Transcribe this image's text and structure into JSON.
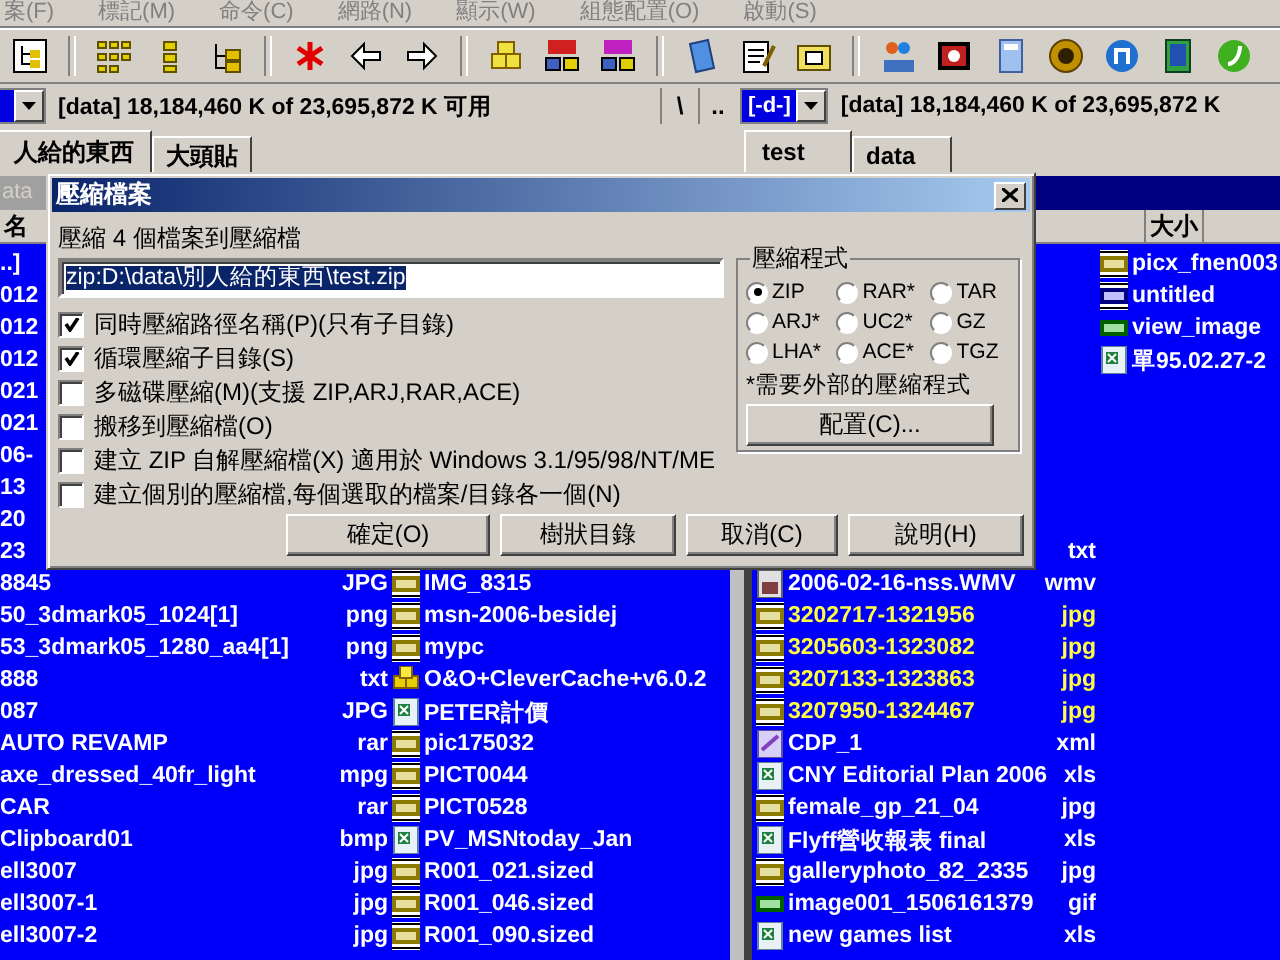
{
  "menu": [
    {
      "label": "案(F)"
    },
    {
      "label": "標記(M)"
    },
    {
      "label": "命令(C)"
    },
    {
      "label": "網路(N)"
    },
    {
      "label": "顯示(W)"
    },
    {
      "label": "組態配置(O)"
    },
    {
      "label": "啟動(S)"
    }
  ],
  "left_drive": {
    "info": "[data]  18,184,460 K of 23,695,872 K 可用"
  },
  "nav_buttons": [
    "\\",
    ".."
  ],
  "right_drive": {
    "drive": "[-d-]",
    "info": "[data]  18,184,460 K of 23,695,872 K"
  },
  "left_tabs": [
    {
      "label": "人給的東西",
      "selected": true
    },
    {
      "label": "大頭貼",
      "selected": false
    }
  ],
  "right_tabs": [
    {
      "label": "test",
      "selected": true
    },
    {
      "label": "data",
      "selected": false
    }
  ],
  "panels": [
    {
      "path": "ata",
      "name_header": "名",
      "columns": [
        [
          {
            "name": "..]",
            "selected": false
          },
          {
            "name": "012",
            "selected": false
          },
          {
            "name": "012",
            "selected": false
          },
          {
            "name": "012",
            "selected": false
          },
          {
            "name": "021",
            "selected": false
          },
          {
            "name": "021",
            "selected": false
          },
          {
            "name": "06-",
            "selected": false
          },
          {
            "name": "13",
            "selected": false
          },
          {
            "name": "20",
            "selected": false
          },
          {
            "name": "23",
            "selected": false
          },
          {
            "name": "8845",
            "ext": "JPG",
            "selected": false
          },
          {
            "name": "50_3dmark05_1024[1]",
            "ext": "png",
            "selected": false
          },
          {
            "name": "53_3dmark05_1280_aa4[1]",
            "ext": "png",
            "selected": false
          },
          {
            "name": "888",
            "ext": "txt",
            "selected": false
          },
          {
            "name": "087",
            "ext": "JPG",
            "selected": false
          },
          {
            "name": "AUTO REVAMP",
            "ext": "rar",
            "selected": false
          },
          {
            "name": "axe_dressed_40fr_light",
            "ext": "mpg",
            "selected": false
          },
          {
            "name": "CAR",
            "ext": "rar",
            "selected": false
          },
          {
            "name": "Clipboard01",
            "ext": "bmp",
            "selected": false
          },
          {
            "name": "ell3007",
            "ext": "jpg",
            "selected": false
          },
          {
            "name": "ell3007-1",
            "ext": "jpg",
            "selected": false
          },
          {
            "name": "ell3007-2",
            "ext": "jpg",
            "selected": false
          }
        ],
        [
          {
            "name": "IMG_8315",
            "kind": "jpg",
            "selected": false
          },
          {
            "name": "msn-2006-besidej",
            "kind": "jpg",
            "selected": false
          },
          {
            "name": "mypc",
            "kind": "jpg",
            "selected": false
          },
          {
            "name": "O&O+CleverCache+v6.0.2",
            "kind": "rar",
            "selected": false
          },
          {
            "name": "PETER計價",
            "kind": "xls",
            "selected": false
          },
          {
            "name": "pic175032",
            "kind": "jpg",
            "selected": false
          },
          {
            "name": "PICT0044",
            "kind": "jpg",
            "selected": false
          },
          {
            "name": "PICT0528",
            "kind": "jpg",
            "selected": false
          },
          {
            "name": "PV_MSNtoday_Jan",
            "kind": "xls",
            "selected": false
          },
          {
            "name": "R001_021.sized",
            "kind": "jpg",
            "selected": false
          },
          {
            "name": "R001_046.sized",
            "kind": "jpg",
            "selected": false
          },
          {
            "name": "R001_090.sized",
            "kind": "jpg",
            "selected": false
          }
        ]
      ]
    },
    {
      "size_header": "大小",
      "columns": [
        [
          {
            "ext": "txt",
            "selected": false
          },
          {
            "name": "2006-02-16-nss.WMV",
            "ext": "wmv",
            "kind": "wmv",
            "selected": false
          },
          {
            "name": "3202717-1321956",
            "ext": "jpg",
            "kind": "jpg",
            "selected": true
          },
          {
            "name": "3205603-1323082",
            "ext": "jpg",
            "kind": "jpg",
            "selected": true
          },
          {
            "name": "3207133-1323863",
            "ext": "jpg",
            "kind": "jpg",
            "selected": true
          },
          {
            "name": "3207950-1324467",
            "ext": "jpg",
            "kind": "jpg",
            "selected": true
          },
          {
            "name": "CDP_1",
            "ext": "xml",
            "kind": "xml",
            "selected": false
          },
          {
            "name": "CNY Editorial Plan 2006",
            "ext": "xls",
            "kind": "xls",
            "selected": false
          },
          {
            "name": "female_gp_21_04",
            "ext": "jpg",
            "kind": "jpg",
            "selected": false
          },
          {
            "name": "Flyff營收報表 final",
            "ext": "xls",
            "kind": "xls",
            "selected": false
          },
          {
            "name": "galleryphoto_82_2335",
            "ext": "jpg",
            "kind": "jpg",
            "selected": false
          },
          {
            "name": "image001_1506161379",
            "ext": "gif",
            "kind": "gif",
            "selected": false
          },
          {
            "name": "new games list",
            "ext": "xls",
            "kind": "xls",
            "selected": false
          }
        ],
        [
          {
            "name": "picx_fnen003",
            "kind": "jpg",
            "selected": false
          },
          {
            "name": "untitled",
            "kind": "bmp",
            "selected": false
          },
          {
            "name": "view_image",
            "kind": "gif",
            "selected": false
          },
          {
            "name": "單95.02.27-2",
            "kind": "xls",
            "selected": false
          }
        ]
      ]
    }
  ],
  "dialog": {
    "title": "壓縮檔案",
    "prompt": "壓縮 4 個檔案到壓縮檔",
    "path": "zip:D:\\data\\別人給的東西\\test.zip",
    "options": [
      {
        "label": "同時壓縮路徑名稱(P)(只有子目錄)",
        "checked": true
      },
      {
        "label": "循環壓縮子目錄(S)",
        "checked": true
      },
      {
        "label": "多磁碟壓縮(M)(支援 ZIP,ARJ,RAR,ACE)",
        "checked": false
      },
      {
        "label": "搬移到壓縮檔(O)",
        "checked": false
      },
      {
        "label": "建立 ZIP 自解壓縮檔(X) 適用於 Windows 3.1/95/98/NT/ME",
        "checked": false
      },
      {
        "label": "建立個別的壓縮檔,每個選取的檔案/目錄各一個(N)",
        "checked": false
      }
    ],
    "packer": {
      "title": "壓縮程式",
      "options": [
        {
          "label": "ZIP",
          "selected": true
        },
        {
          "label": "RAR*",
          "selected": false
        },
        {
          "label": "TAR",
          "selected": false
        },
        {
          "label": "ARJ*",
          "selected": false
        },
        {
          "label": "UC2*",
          "selected": false
        },
        {
          "label": "GZ",
          "selected": false
        },
        {
          "label": "LHA*",
          "selected": false
        },
        {
          "label": "ACE*",
          "selected": false
        },
        {
          "label": "TGZ",
          "selected": false
        }
      ],
      "note": "*需要外部的壓縮程式",
      "config_button": "配置(C)..."
    },
    "buttons": [
      "確定(O)",
      "樹狀目錄",
      "取消(C)",
      "說明(H)"
    ]
  }
}
